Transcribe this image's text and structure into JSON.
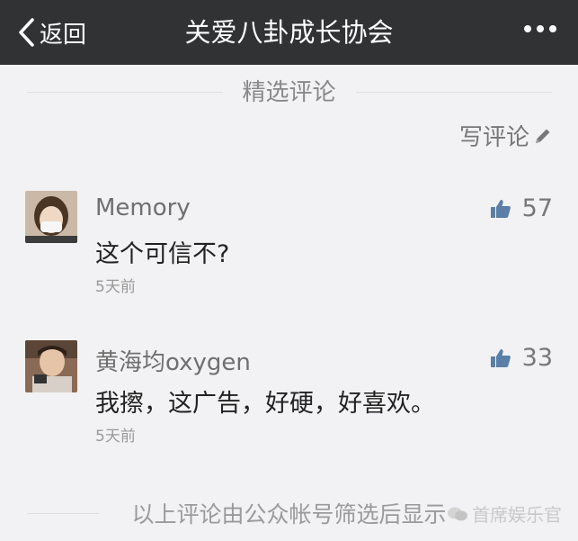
{
  "navbar": {
    "back_label": "返回",
    "title": "关爱八卦成长协会"
  },
  "section": {
    "label": "精选评论"
  },
  "write_comment": {
    "label": "写评论"
  },
  "comments": [
    {
      "name": "Memory",
      "likes": "57",
      "content": "这个可信不?",
      "time": "5天前"
    },
    {
      "name": "黄海均oxygen",
      "likes": "33",
      "content": "我擦，这广告，好硬，好喜欢。",
      "time": "5天前"
    }
  ],
  "footer": {
    "note": "以上评论由公众帐号筛选后显示",
    "watermark": "首席娱乐官"
  },
  "colors": {
    "navbar_bg": "#313234",
    "page_bg": "#f2f2f4",
    "accent_icon": "#5b7fa6"
  }
}
